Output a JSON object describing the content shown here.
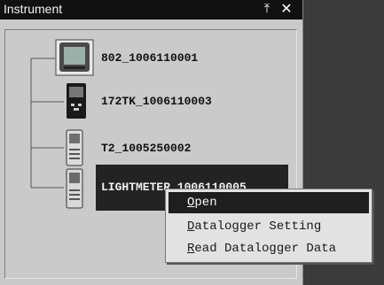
{
  "panel": {
    "title": "Instrument",
    "pin_glyph": "⤒",
    "close_glyph": "✕"
  },
  "tree": {
    "items": [
      {
        "label": "802_1006110001",
        "icon": "device-802-icon"
      },
      {
        "label": "172TK_1006110003",
        "icon": "device-172tk-icon"
      },
      {
        "label": "T2_1005250002",
        "icon": "device-t2-icon"
      },
      {
        "label": "LIGHTMETER_1006110005",
        "icon": "device-lightmeter-icon",
        "selected": true
      }
    ]
  },
  "context_menu": {
    "items": [
      {
        "label": "Open",
        "accel": "O",
        "rest": "pen",
        "active": true
      },
      {
        "label": "Datalogger Setting",
        "accel": "D",
        "rest": "atalogger Setting"
      },
      {
        "label": "Read Datalogger Data",
        "accel": "R",
        "rest": "ead Datalogger Data"
      }
    ]
  }
}
